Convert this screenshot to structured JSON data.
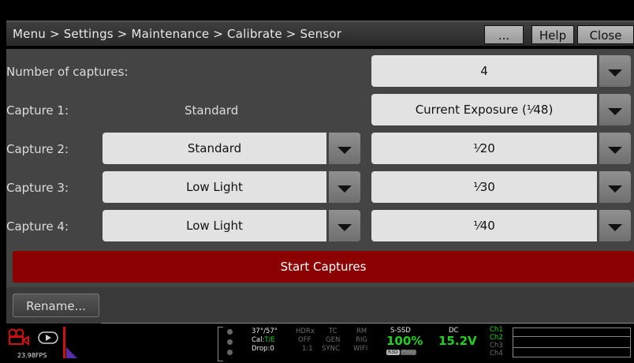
{
  "titlebar": {
    "breadcrumb": "Menu > Settings > Maintenance > Calibrate > Sensor",
    "more_label": "...",
    "help_label": "Help",
    "close_label": "Close"
  },
  "form": {
    "num_captures_label": "Number of captures:",
    "num_captures_value": "4",
    "rows": [
      {
        "label": "Capture 1:",
        "mode": "Standard",
        "exposure": "Current Exposure (¹⁄48)"
      },
      {
        "label": "Capture 2:",
        "mode": "Standard",
        "exposure": "¹⁄20"
      },
      {
        "label": "Capture 3:",
        "mode": "Low Light",
        "exposure": "¹⁄30"
      },
      {
        "label": "Capture 4:",
        "mode": "Low Light",
        "exposure": "¹⁄40"
      }
    ],
    "start_label": "Start Captures",
    "rename_label": "Rename..."
  },
  "status": {
    "fps": "23.98FPS",
    "temp": "37°/57°",
    "cal_prefix": "Cal:",
    "cal_value": "T/E",
    "drop": "Drop:0",
    "hdrx": "HDRx",
    "off": "OFF",
    "ratio": "1:1",
    "tc": "TC",
    "gen": "GEN",
    "sync": "SYNC",
    "rm": "RM",
    "rig": "RIG",
    "wifi": "WIFI",
    "media_label": "S-SSD",
    "media_value": "100%",
    "r3d_badge": "R3D",
    "proxy_badge": "Proxy",
    "dc_label": "DC",
    "dc_value": "15.2V",
    "channels": [
      "Ch1",
      "Ch2",
      "Ch3",
      "Ch4"
    ],
    "colors": {
      "green": "#20d020",
      "red_bar": "#d01010",
      "purple": "#5a2da8"
    }
  }
}
